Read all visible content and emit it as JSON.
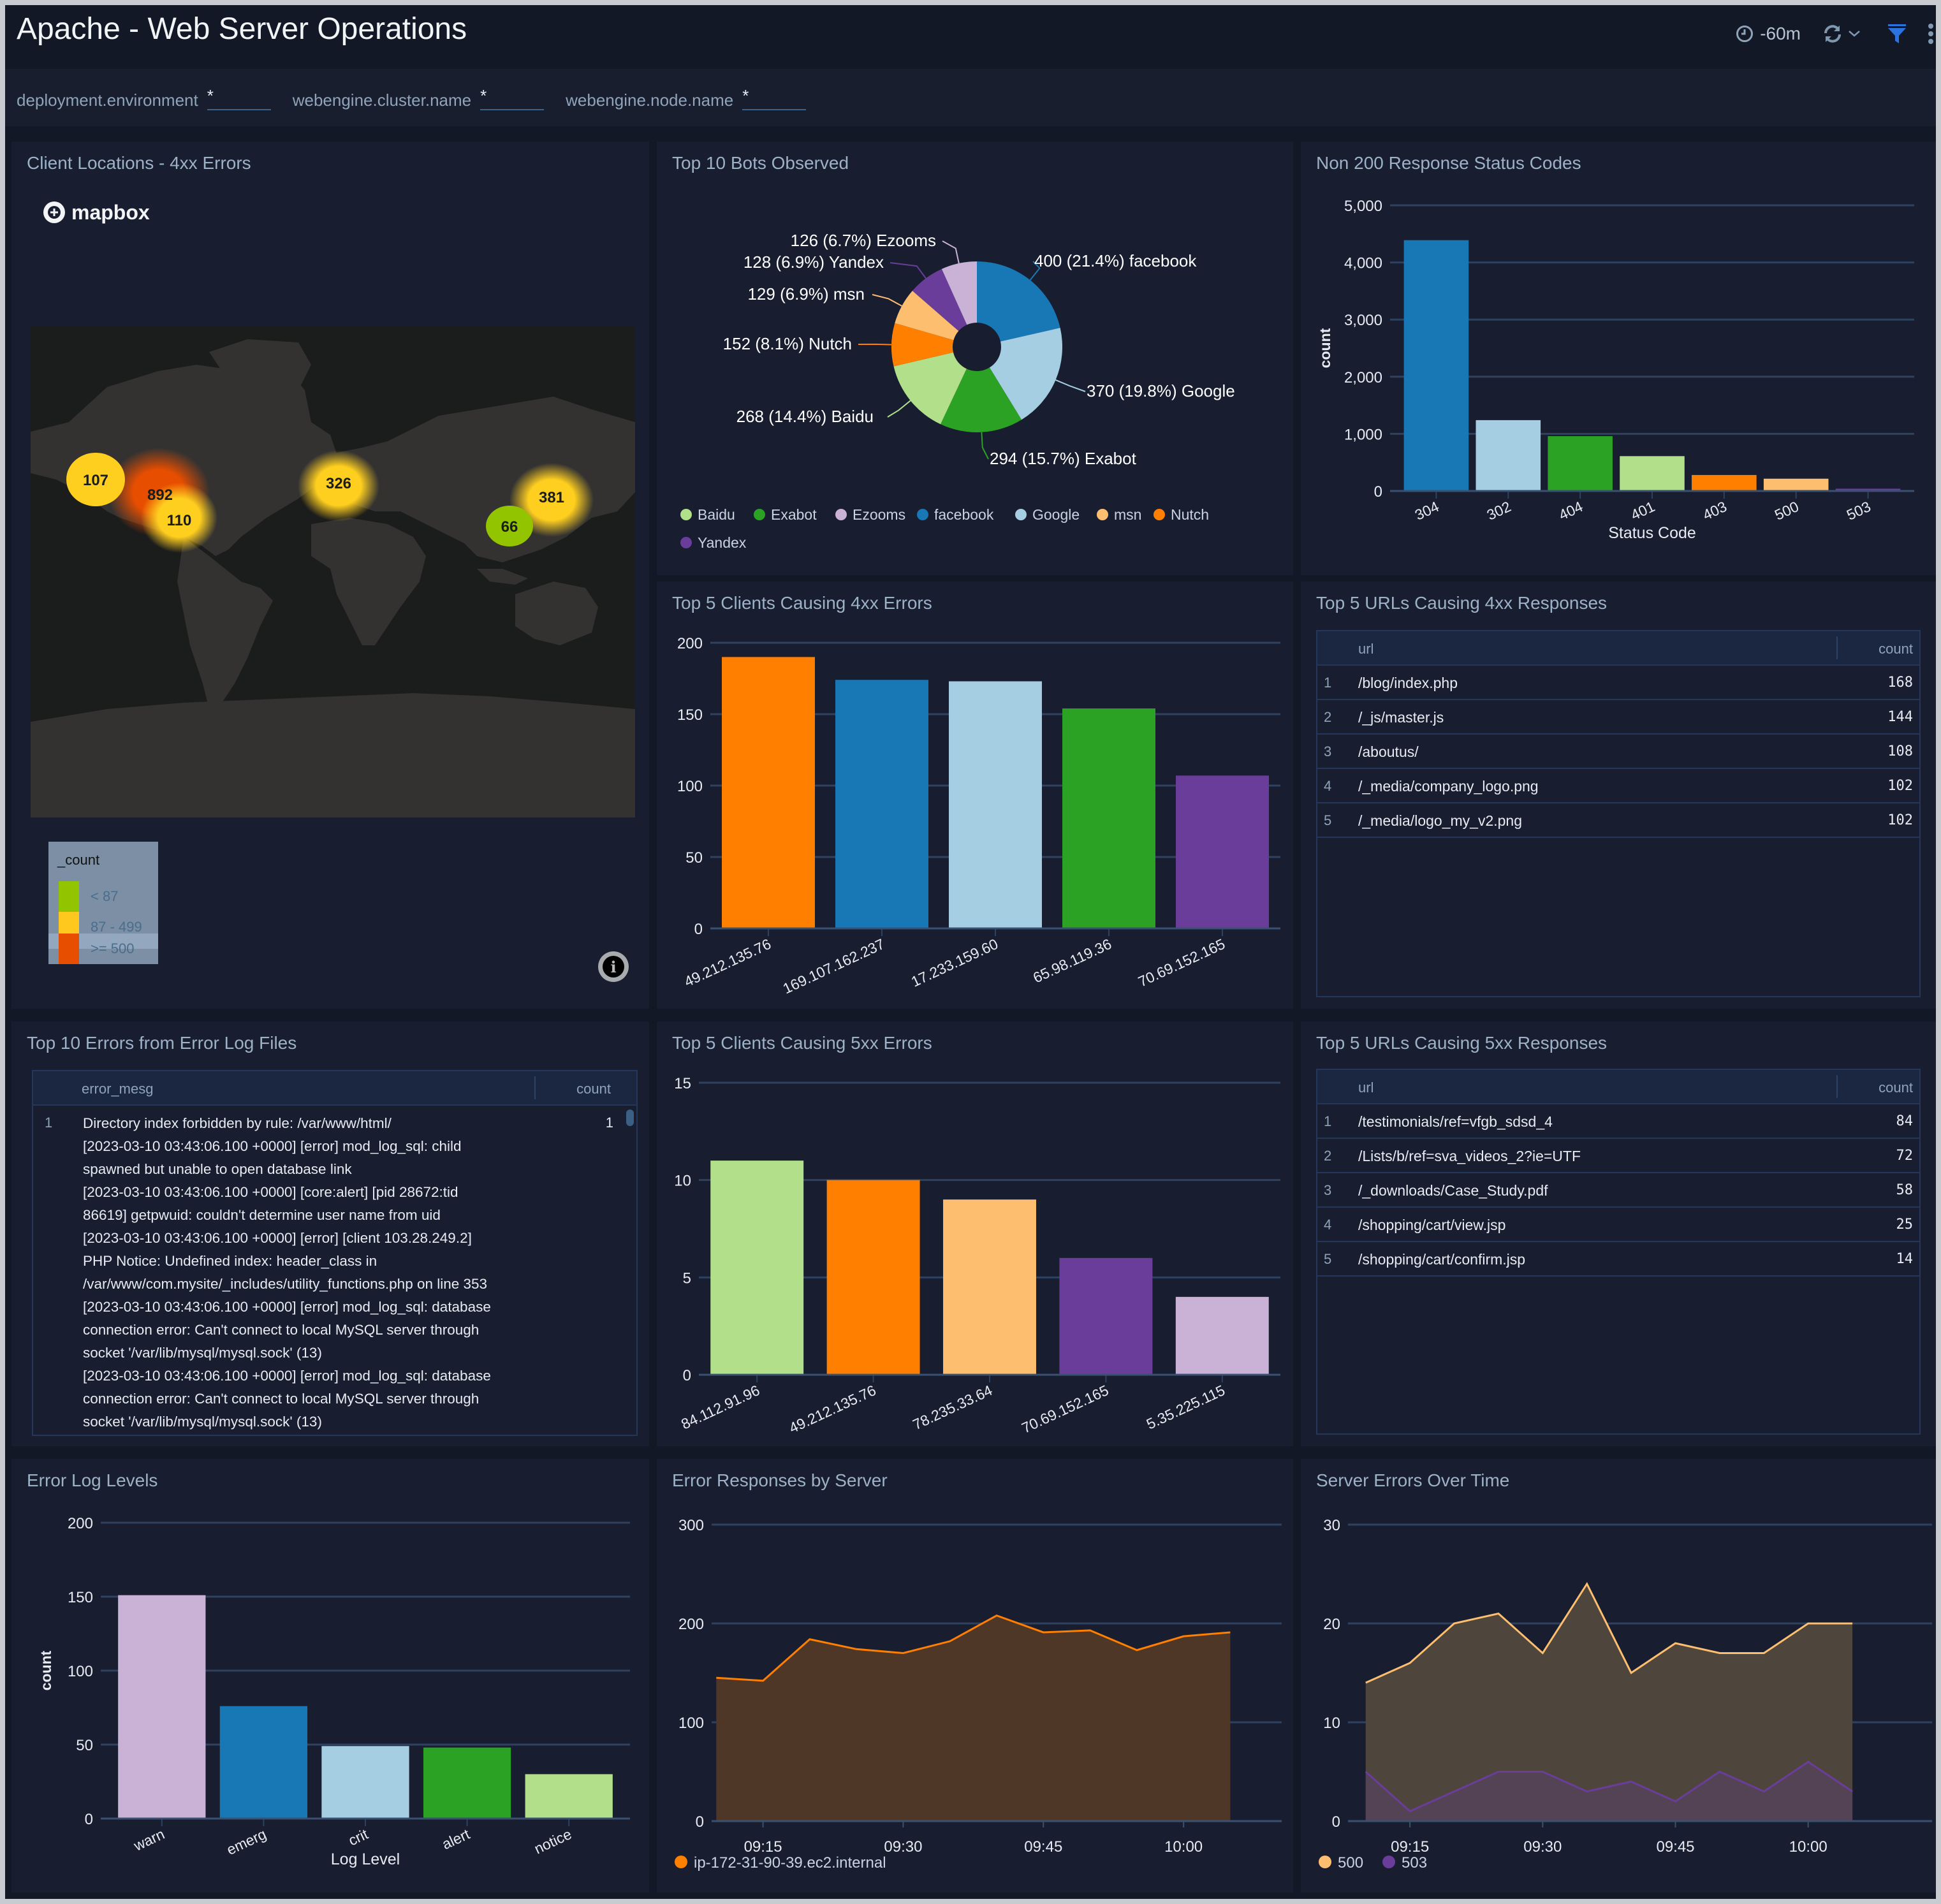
{
  "header": {
    "title": "Apache - Web Server Operations",
    "time_range": "-60m",
    "icons": [
      "clock-icon",
      "refresh-icon",
      "chevron-down-icon",
      "filter-icon",
      "kebab-menu-icon"
    ],
    "colors": {
      "filter_accent": "#2a73e0"
    }
  },
  "filters": [
    {
      "label": "deployment.environment",
      "value": "*"
    },
    {
      "label": "webengine.cluster.name",
      "value": "*"
    },
    {
      "label": "webengine.node.name",
      "value": "*"
    }
  ],
  "panels": {
    "client_locations": {
      "title": "Client Locations - 4xx Errors",
      "provider": "mapbox",
      "clusters": [
        {
          "value": "107",
          "region": "US West",
          "bucket": "87 - 499"
        },
        {
          "value": "892",
          "region": "US Central",
          "bucket": ">= 500"
        },
        {
          "value": "110",
          "region": "Central America",
          "bucket": "87 - 499"
        },
        {
          "value": "326",
          "region": "Europe",
          "bucket": "87 - 499"
        },
        {
          "value": "381",
          "region": "East Asia",
          "bucket": "87 - 499"
        },
        {
          "value": "66",
          "region": "Southeast Asia",
          "bucket": "< 87"
        }
      ],
      "legend": {
        "title": "_count",
        "items": [
          {
            "label": "< 87",
            "color": "#93c400"
          },
          {
            "label": "87 - 499",
            "color": "#ffc81f"
          },
          {
            "label": ">= 500",
            "color": "#e84e00"
          }
        ]
      }
    },
    "top_bots": {
      "title": "Top 10 Bots Observed"
    },
    "status_codes": {
      "title": "Non 200 Response Status Codes"
    },
    "clients_4xx": {
      "title": "Top 5 Clients Causing 4xx Errors"
    },
    "urls_4xx": {
      "title": "Top 5 URLs Causing 4xx Responses",
      "columns": [
        "url",
        "count"
      ],
      "rows": [
        {
          "idx": "1",
          "url": "/blog/index.php",
          "count": "168"
        },
        {
          "idx": "2",
          "url": "/_js/master.js",
          "count": "144"
        },
        {
          "idx": "3",
          "url": "/aboutus/",
          "count": "108"
        },
        {
          "idx": "4",
          "url": "/_media/company_logo.png",
          "count": "102"
        },
        {
          "idx": "5",
          "url": "/_media/logo_my_v2.png",
          "count": "102"
        }
      ]
    },
    "error_log": {
      "title": "Top 10 Errors from Error Log Files",
      "columns": [
        "error_mesg",
        "count"
      ],
      "rows": [
        {
          "idx": "1",
          "message": "Directory index forbidden by rule: /var/www/html/\n[2023-03-10 03:43:06.100 +0000] [error] mod_log_sql: child\nspawned but unable to open database link\n[2023-03-10 03:43:06.100 +0000] [core:alert] [pid 28672:tid\n86619] getpwuid: couldn't determine user name from uid\n[2023-03-10 03:43:06.100 +0000] [error] [client 103.28.249.2]\nPHP Notice: Undefined index: header_class in\n/var/www/com.mysite/_includes/utility_functions.php on line 353\n[2023-03-10 03:43:06.100 +0000] [error] mod_log_sql: database\nconnection error: Can't connect to local MySQL server through\nsocket '/var/lib/mysql/mysql.sock' (13)\n[2023-03-10 03:43:06.100 +0000] [error] mod_log_sql: database\nconnection error: Can't connect to local MySQL server through\nsocket '/var/lib/mysql/mysql.sock' (13)",
          "count": "1"
        }
      ]
    },
    "clients_5xx": {
      "title": "Top 5 Clients Causing 5xx Errors"
    },
    "urls_5xx": {
      "title": "Top 5 URLs Causing 5xx Responses",
      "columns": [
        "url",
        "count"
      ],
      "rows": [
        {
          "idx": "1",
          "url": "/testimonials/ref=vfgb_sdsd_4",
          "count": "84"
        },
        {
          "idx": "2",
          "url": "/Lists/b/ref=sva_videos_2?ie=UTF",
          "count": "72"
        },
        {
          "idx": "3",
          "url": "/_downloads/Case_Study.pdf",
          "count": "58"
        },
        {
          "idx": "4",
          "url": "/shopping/cart/view.jsp",
          "count": "25"
        },
        {
          "idx": "5",
          "url": "/shopping/cart/confirm.jsp",
          "count": "14"
        }
      ]
    },
    "log_levels": {
      "title": "Error Log Levels"
    },
    "error_by_server": {
      "title": "Error Responses by Server"
    },
    "server_errors": {
      "title": "Server Errors Over Time"
    }
  },
  "chart_data": [
    {
      "id": "top_bots",
      "type": "pie",
      "title": "Top 10 Bots Observed",
      "donut": true,
      "slices": [
        {
          "label": "facebook",
          "value": 400,
          "pct": "21.4%",
          "color": "#1878b6"
        },
        {
          "label": "Google",
          "value": 370,
          "pct": "19.8%",
          "color": "#a6cee3"
        },
        {
          "label": "Exabot",
          "value": 294,
          "pct": "15.7%",
          "color": "#2ca225"
        },
        {
          "label": "Baidu",
          "value": 268,
          "pct": "14.4%",
          "color": "#b2df8a"
        },
        {
          "label": "Nutch",
          "value": 152,
          "pct": "8.1%",
          "color": "#ff7f00"
        },
        {
          "label": "msn",
          "value": 129,
          "pct": "6.9%",
          "color": "#fdbf6f"
        },
        {
          "label": "Yandex",
          "value": 128,
          "pct": "6.9%",
          "color": "#6a3d9a"
        },
        {
          "label": "Ezooms",
          "value": 126,
          "pct": "6.7%",
          "color": "#cab2d6"
        }
      ],
      "legend": [
        "Baidu",
        "Exabot",
        "Ezooms",
        "facebook",
        "Google",
        "msn",
        "Nutch",
        "Yandex"
      ],
      "legend_position": "bottom"
    },
    {
      "id": "status_codes",
      "type": "bar",
      "title": "Non 200 Response Status Codes",
      "categories": [
        "304",
        "302",
        "404",
        "401",
        "403",
        "500",
        "503"
      ],
      "values": [
        4390,
        1240,
        960,
        610,
        280,
        215,
        40
      ],
      "colors": [
        "#1878b6",
        "#a6cee3",
        "#2ca225",
        "#b2df8a",
        "#ff7f00",
        "#fdbf6f",
        "#6a3d9a"
      ],
      "xlabel": "Status Code",
      "ylabel": "count",
      "ylim": [
        0,
        5000
      ],
      "yticks": [
        0,
        1000,
        2000,
        3000,
        4000,
        5000
      ],
      "ytick_labels": [
        "0",
        "1,000",
        "2,000",
        "3,000",
        "4,000",
        "5,000"
      ],
      "grid": true
    },
    {
      "id": "clients_4xx",
      "type": "bar",
      "title": "Top 5 Clients Causing 4xx Errors",
      "categories": [
        "49.212.135.76",
        "169.107.162.237",
        "17.233.159.60",
        "65.98.119.36",
        "70.69.152.165"
      ],
      "values": [
        190,
        174,
        173,
        154,
        107
      ],
      "colors": [
        "#ff7f00",
        "#1878b6",
        "#a6cee3",
        "#2ca225",
        "#6a3d9a"
      ],
      "xlabel": "",
      "ylabel": "",
      "ylim": [
        0,
        200
      ],
      "yticks": [
        0,
        50,
        100,
        150,
        200
      ],
      "ytick_labels": [
        "0",
        "50",
        "100",
        "150",
        "200"
      ],
      "grid": true
    },
    {
      "id": "clients_5xx",
      "type": "bar",
      "title": "Top 5 Clients Causing 5xx Errors",
      "categories": [
        "84.112.91.96",
        "49.212.135.76",
        "78.235.33.64",
        "70.69.152.165",
        "5.35.225.115"
      ],
      "values": [
        11,
        10,
        9,
        6,
        4
      ],
      "colors": [
        "#b2df8a",
        "#ff7f00",
        "#fdbf6f",
        "#6a3d9a",
        "#cab2d6"
      ],
      "xlabel": "",
      "ylabel": "",
      "ylim": [
        0,
        15
      ],
      "yticks": [
        0,
        5,
        10,
        15
      ],
      "ytick_labels": [
        "0",
        "5",
        "10",
        "15"
      ],
      "grid": true
    },
    {
      "id": "log_levels",
      "type": "bar",
      "title": "Error Log Levels",
      "categories": [
        "warn",
        "emerg",
        "crit",
        "alert",
        "notice"
      ],
      "values": [
        151,
        76,
        49,
        48,
        30
      ],
      "colors": [
        "#cab2d6",
        "#1878b6",
        "#a6cee3",
        "#2ca225",
        "#b2df8a"
      ],
      "xlabel": "Log Level",
      "ylabel": "count",
      "ylim": [
        0,
        200
      ],
      "yticks": [
        0,
        50,
        100,
        150,
        200
      ],
      "ytick_labels": [
        "0",
        "50",
        "100",
        "150",
        "200"
      ],
      "grid": true
    },
    {
      "id": "error_by_server",
      "type": "area",
      "title": "Error Responses by Server",
      "x": [
        "09:10",
        "09:15",
        "09:20",
        "09:25",
        "09:30",
        "09:35",
        "09:40",
        "09:45",
        "09:50",
        "09:55",
        "10:00",
        "10:05"
      ],
      "xticks": [
        "09:15",
        "09:30",
        "09:45",
        "10:00"
      ],
      "xlim_minutes": [
        9.5,
        70.5
      ],
      "series": [
        {
          "name": "ip-172-31-90-39.ec2.internal",
          "color": "#ff7f00",
          "fill": "#4f3727",
          "values": [
            145,
            142,
            184,
            174,
            170,
            182,
            208,
            191,
            193,
            173,
            187,
            191
          ]
        }
      ],
      "ylim": [
        0,
        300
      ],
      "yticks": [
        0,
        100,
        200,
        300
      ],
      "ytick_labels": [
        "0",
        "100",
        "200",
        "300"
      ],
      "legend_position": "bottom-left",
      "grid": true
    },
    {
      "id": "server_errors",
      "type": "area",
      "title": "Server Errors Over Time",
      "x": [
        "09:10",
        "09:15",
        "09:20",
        "09:25",
        "09:30",
        "09:35",
        "09:40",
        "09:45",
        "09:50",
        "09:55",
        "10:00",
        "10:05"
      ],
      "xticks": [
        "09:15",
        "09:30",
        "09:45",
        "10:00"
      ],
      "xlim_minutes": [
        8.0,
        74.0
      ],
      "series": [
        {
          "name": "500",
          "color": "#fdbf6f",
          "fill": "#4e453c",
          "values": [
            14,
            16,
            20,
            21,
            17,
            24,
            15,
            18,
            17,
            17,
            20,
            20
          ]
        },
        {
          "name": "503",
          "color": "#6a3d9a",
          "fill": "#554357",
          "values": [
            5,
            1,
            3,
            5,
            5,
            3,
            4,
            2,
            5,
            3,
            6,
            3
          ]
        }
      ],
      "ylim": [
        0,
        30
      ],
      "yticks": [
        0,
        10,
        20,
        30
      ],
      "ytick_labels": [
        "0",
        "10",
        "20",
        "30"
      ],
      "legend_position": "bottom-left",
      "grid": true
    }
  ]
}
